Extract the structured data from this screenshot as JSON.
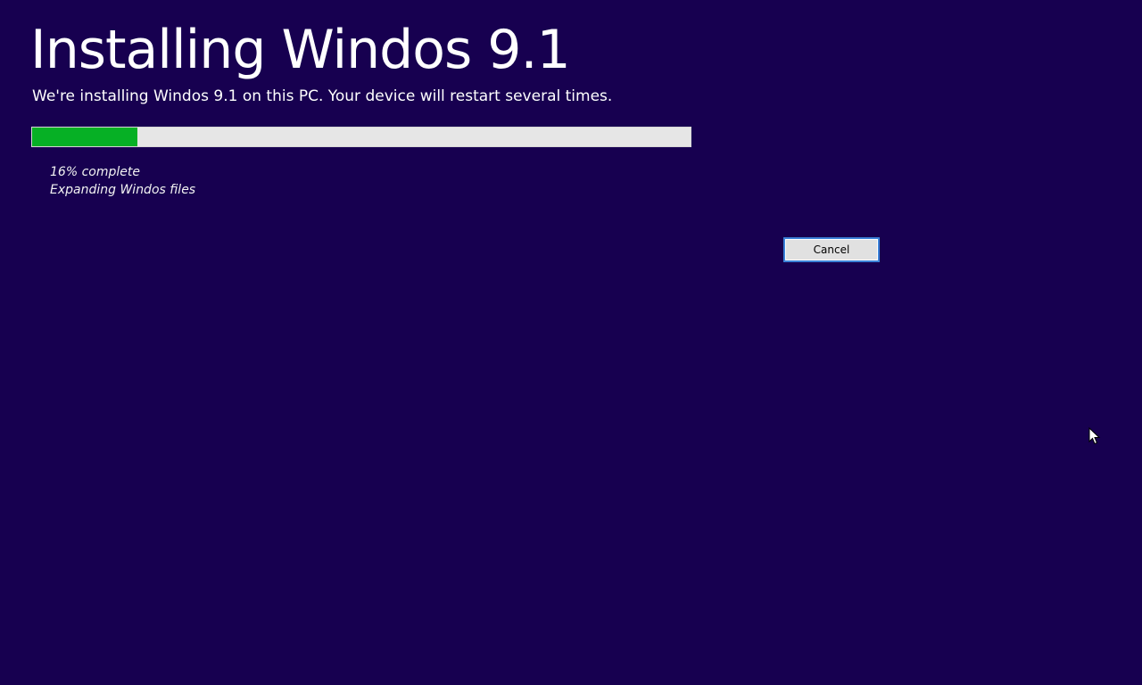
{
  "colors": {
    "background": "#170050",
    "progress_fill": "#06b025",
    "progress_track": "#e6e6e6",
    "button_border": "#3c82d8"
  },
  "header": {
    "title": "Installing Windos 9.1",
    "subtitle": "We're installing Windos 9.1 on this PC. Your device will restart several times."
  },
  "progress": {
    "percent": 16,
    "status_line": "16% complete",
    "detail_line": "Expanding Windos files"
  },
  "actions": {
    "cancel_label": "Cancel"
  },
  "icons": {
    "cursor": "mouse-pointer-icon"
  }
}
